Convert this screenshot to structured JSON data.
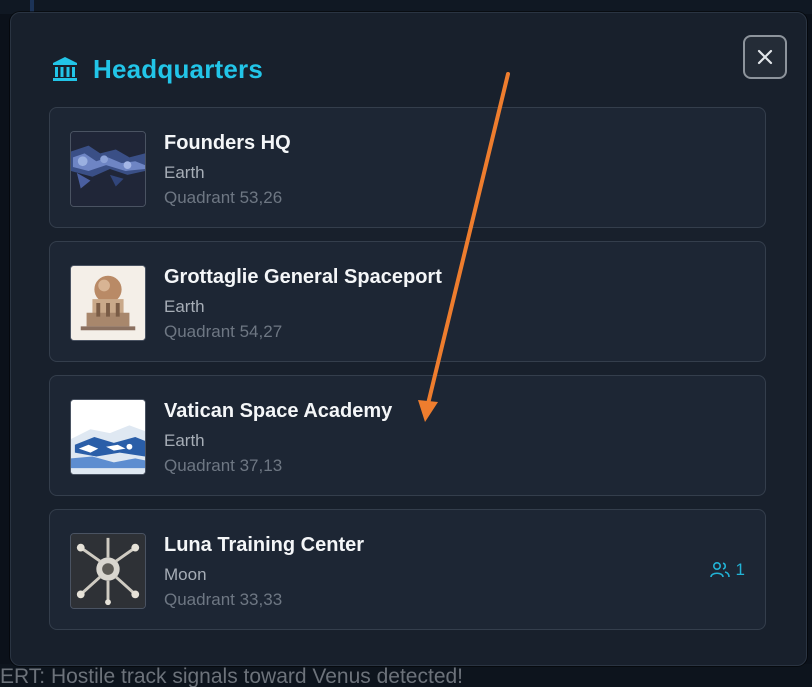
{
  "background": {
    "alert_text": "ERT: Hostile track signals toward Venus detected!"
  },
  "modal": {
    "title": "Headquarters",
    "title_icon": "bank-building-icon",
    "close_icon": "close-icon",
    "accent_color": "#22c5e8",
    "items": [
      {
        "name": "Founders HQ",
        "planet": "Earth",
        "quadrant": "Quadrant 53,26",
        "occupancy": ""
      },
      {
        "name": "Grottaglie General Spaceport",
        "planet": "Earth",
        "quadrant": "Quadrant 54,27",
        "occupancy": ""
      },
      {
        "name": "Vatican Space Academy",
        "planet": "Earth",
        "quadrant": "Quadrant 37,13",
        "occupancy": ""
      },
      {
        "name": "Luna Training Center",
        "planet": "Moon",
        "quadrant": "Quadrant 33,33",
        "occupancy": "1",
        "occupancy_icon": "users-icon"
      }
    ]
  },
  "annotation": {
    "arrow_color": "#ee7d2e"
  }
}
